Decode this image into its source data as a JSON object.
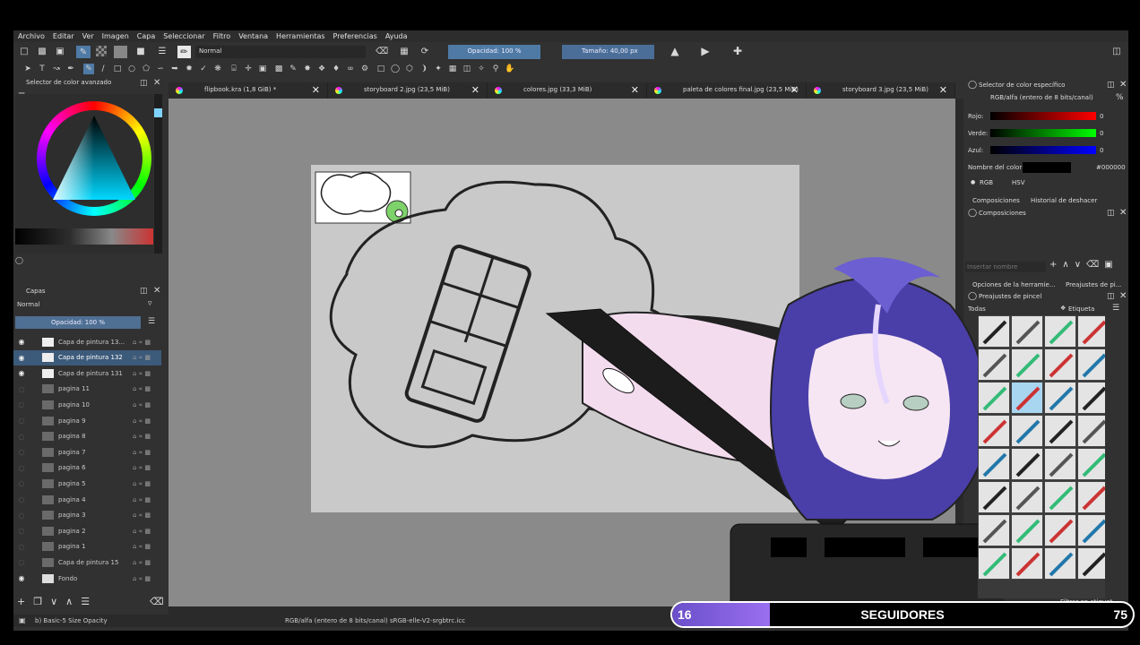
{
  "menu": [
    "Archivo",
    "Editar",
    "Ver",
    "Imagen",
    "Capa",
    "Seleccionar",
    "Filtro",
    "Ventana",
    "Herramientas",
    "Preferencias",
    "Ayuda"
  ],
  "toolbar": {
    "blend_mode": "Normal",
    "opacity_label": "Opacidad: 100 %",
    "size_label": "Tamaño: 40,00 px"
  },
  "left_panel": {
    "color_selector_title": "Selector de color avanzado",
    "layers_title": "Capas",
    "layer_blend": "Normal",
    "layer_opacity": "Opacidad:  100 %",
    "layers": [
      {
        "name": "Capa de pintura 13...",
        "visible": true,
        "selected": false
      },
      {
        "name": "Capa de pintura 132",
        "visible": true,
        "selected": true
      },
      {
        "name": "Capa de pintura 131",
        "visible": true,
        "selected": false
      },
      {
        "name": "pagina 11",
        "visible": false,
        "selected": false
      },
      {
        "name": "pagina 10",
        "visible": false,
        "selected": false
      },
      {
        "name": "pagina 9",
        "visible": false,
        "selected": false
      },
      {
        "name": "pagina 8",
        "visible": false,
        "selected": false
      },
      {
        "name": "pagina 7",
        "visible": false,
        "selected": false
      },
      {
        "name": "pagina 6",
        "visible": false,
        "selected": false
      },
      {
        "name": "pagina 5",
        "visible": false,
        "selected": false
      },
      {
        "name": "pagina 4",
        "visible": false,
        "selected": false
      },
      {
        "name": "pagina 3",
        "visible": false,
        "selected": false
      },
      {
        "name": "pagina 2",
        "visible": false,
        "selected": false
      },
      {
        "name": "pagina 1",
        "visible": false,
        "selected": false
      },
      {
        "name": "Capa de pintura 15",
        "visible": false,
        "selected": false
      },
      {
        "name": "Fondo",
        "visible": true,
        "selected": false
      }
    ]
  },
  "tabs": [
    {
      "label": "flipbook.kra (1,8 GiB) *"
    },
    {
      "label": "storyboard 2.jpg (23,5 MiB)"
    },
    {
      "label": "colores.jpg (33,3 MiB)"
    },
    {
      "label": "paleta de colores final.jpg (23,5 MiB)"
    },
    {
      "label": "storyboard 3.jpg (23,5 MiB)"
    }
  ],
  "right_panel": {
    "specific_color_title": "Selector de color específico",
    "color_model": "RGB/alfa (entero de 8 bits/canal)",
    "red_label": "Rojo:",
    "green_label": "Verde:",
    "blue_label": "Azul:",
    "red_value": "0",
    "green_value": "0",
    "blue_value": "0",
    "color_name_label": "Nombre del color:",
    "hex_value": "#000000",
    "rgb_option": "RGB",
    "hsv_option": "HSV",
    "tab_compositions": "Composiciones",
    "tab_undo": "Historial de deshacer",
    "compositions_title": "Composiciones",
    "insert_name_placeholder": "Insertar nombre",
    "tab_tool_options": "Opciones de la herramie...",
    "tab_brush_presets": "Preajustes de pi...",
    "brush_presets_title": "Preajustes de pincel",
    "filter_all": "Todas",
    "tag_label": "Etiqueta",
    "filter_tags": "Filtrar en etiquet"
  },
  "status": {
    "brush": "b) Basic-5 Size Opacity",
    "color_profile": "RGB/alfa (entero de 8 bits/canal)  sRGB-elle-V2-srgbtrc.icc"
  },
  "overlay": {
    "current": "16",
    "title": "SEGUIDORES",
    "goal": "75",
    "progress": 0.213
  },
  "colors": {
    "accent": "#4f7aa5",
    "selected_layer": "#3c5a7a",
    "overlay_fill": "#7b5ad9"
  }
}
